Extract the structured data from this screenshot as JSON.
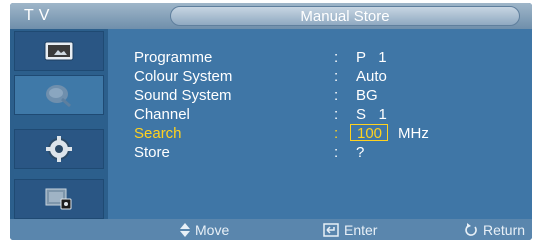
{
  "header": {
    "source_label": "TV",
    "title": "Manual Store"
  },
  "sidebar": {
    "items": [
      {
        "icon": "picture-icon"
      },
      {
        "icon": "sound-satellite-icon"
      },
      {
        "icon": "setup-gear-icon"
      },
      {
        "icon": "input-icon"
      }
    ]
  },
  "menu": {
    "rows": [
      {
        "label": "Programme",
        "colon": ":",
        "value": "P   1"
      },
      {
        "label": "Colour System",
        "colon": ":",
        "value": "Auto"
      },
      {
        "label": "Sound System",
        "colon": ":",
        "value": "BG"
      },
      {
        "label": "Channel",
        "colon": ":",
        "value": "S   1"
      },
      {
        "label": "Search",
        "colon": ":",
        "value": "100",
        "unit": "MHz"
      },
      {
        "label": "Store",
        "colon": ":",
        "value": "?"
      }
    ]
  },
  "footer": {
    "move_label": "Move",
    "enter_label": "Enter",
    "return_label": "Return"
  },
  "colors": {
    "highlight": "#ffd21f",
    "panel": "#3f76a6"
  }
}
